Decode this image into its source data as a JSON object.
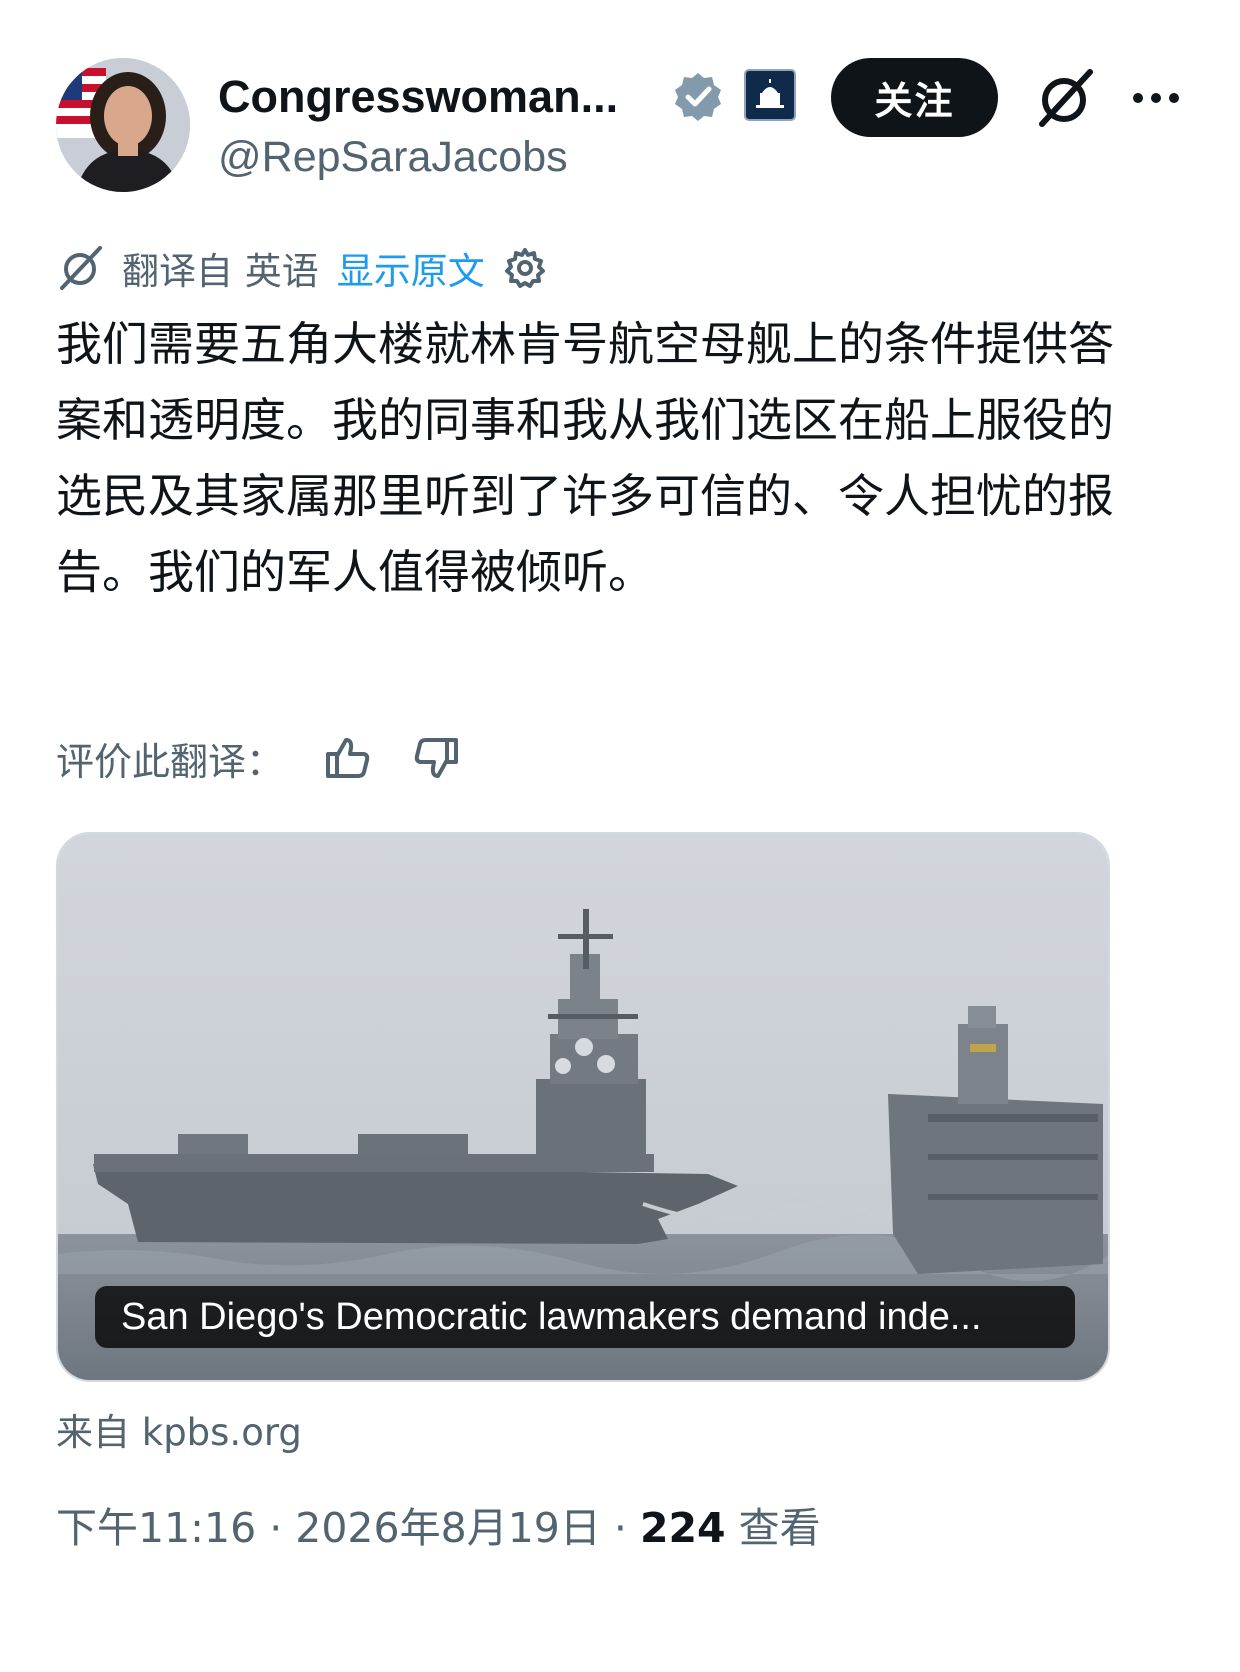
{
  "author": {
    "display_name": "Congresswoman...",
    "handle": "@RepSaraJacobs",
    "verified_icon": "verified-badge-icon",
    "affiliation_icon": "capitol-badge-icon"
  },
  "actions": {
    "follow_label": "关注",
    "grok_icon": "grok-icon",
    "more_icon": "more-icon"
  },
  "translation": {
    "label": "翻译自 英语",
    "show_original": "显示原文",
    "settings_icon": "gear-icon"
  },
  "tweet": {
    "text": "我们需要五角大楼就林肯号航空母舰上的条件提供答案和透明度。我的同事和我从我们选区在船上服役的选民及其家属那里听到了许多可信的、令人担忧的报告。我们的军人值得被倾听。"
  },
  "rate": {
    "label": "评价此翻译："
  },
  "card": {
    "caption": "San Diego's Democratic lawmakers demand inde...",
    "source": "来自 kpbs.org"
  },
  "meta": {
    "time": "下午11:16",
    "date": "2026年8月19日",
    "views_count": "224",
    "views_label": "查看"
  },
  "colors": {
    "text": "#0f1419",
    "secondary": "#536471",
    "link": "#1d9bf0",
    "follow_bg": "#0f1419"
  }
}
